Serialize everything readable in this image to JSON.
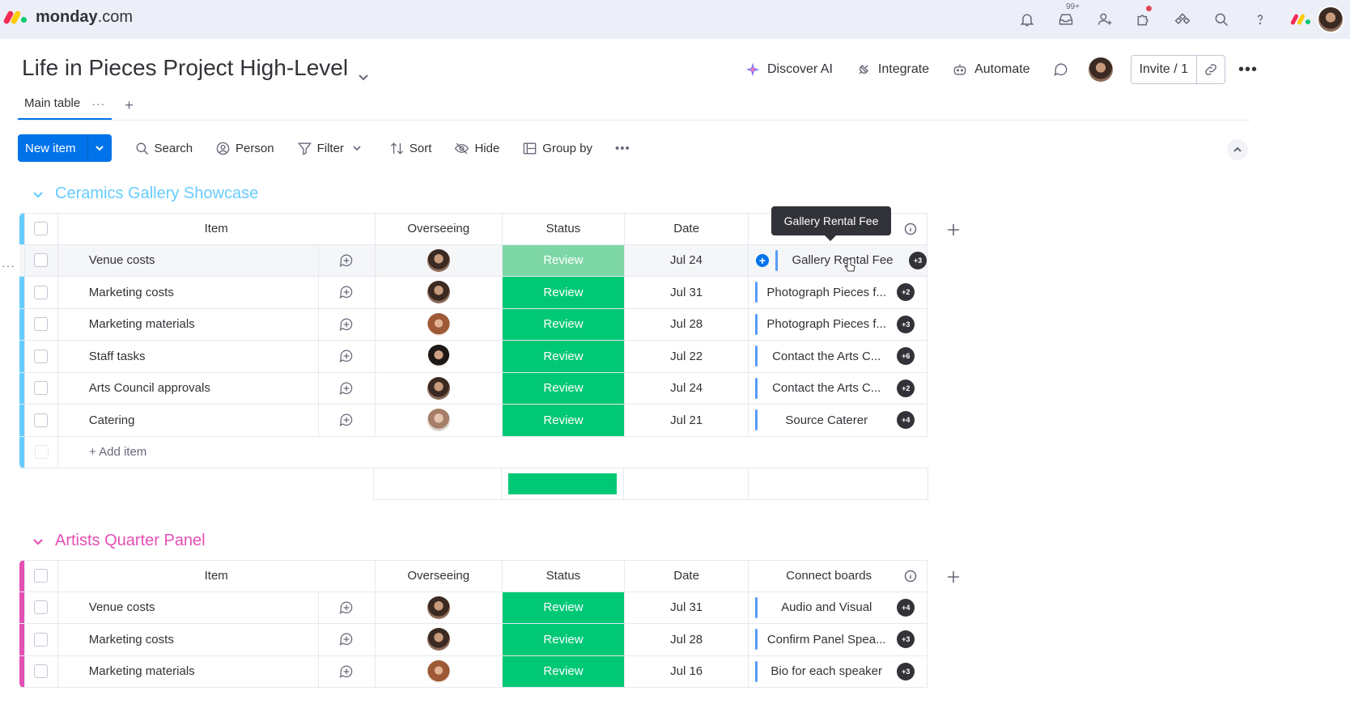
{
  "app": {
    "logo_bold": "monday",
    "logo_rest": ".com",
    "notification_badge": "99+",
    "icons": [
      "bell-icon",
      "inbox-icon",
      "invite-user-icon",
      "puzzle-icon",
      "integrations-icon",
      "search-icon",
      "help-icon"
    ]
  },
  "board": {
    "title": "Life in Pieces Project High-Level",
    "actions": {
      "discover_ai": "Discover AI",
      "integrate": "Integrate",
      "automate": "Automate",
      "invite": "Invite / 1"
    },
    "tabs": [
      {
        "label": "Main table"
      }
    ]
  },
  "toolbar": {
    "new_item": "New item",
    "search": "Search",
    "person": "Person",
    "filter": "Filter",
    "sort": "Sort",
    "hide": "Hide",
    "group_by": "Group by"
  },
  "columns": {
    "item": "Item",
    "overseeing": "Overseeing",
    "status": "Status",
    "date": "Date",
    "connect_boards": "Connect boards"
  },
  "tooltip": "Gallery Rental Fee",
  "colors": {
    "accent": "#0073ea",
    "status_review": "#00c875",
    "group1": "#66ccff",
    "group2": "#e44fb4"
  },
  "groups": [
    {
      "title": "Ceramics Gallery Showcase",
      "add_item": "+ Add item",
      "rows": [
        {
          "item": "Venue costs",
          "status": "Review",
          "date": "Jul 24",
          "connect": "Gallery Rental Fee",
          "more": "+3"
        },
        {
          "item": "Marketing costs",
          "status": "Review",
          "date": "Jul 31",
          "connect": "Photograph Pieces f...",
          "more": "+2"
        },
        {
          "item": "Marketing materials",
          "status": "Review",
          "date": "Jul 28",
          "connect": "Photograph Pieces f...",
          "more": "+3"
        },
        {
          "item": "Staff tasks",
          "status": "Review",
          "date": "Jul 22",
          "connect": "Contact the Arts C...",
          "more": "+6"
        },
        {
          "item": "Arts Council approvals",
          "status": "Review",
          "date": "Jul 24",
          "connect": "Contact the Arts C...",
          "more": "+2"
        },
        {
          "item": "Catering",
          "status": "Review",
          "date": "Jul 21",
          "connect": "Source Caterer",
          "more": "+4"
        }
      ]
    },
    {
      "title": "Artists Quarter Panel",
      "rows": [
        {
          "item": "Venue costs",
          "status": "Review",
          "date": "Jul 31",
          "connect": "Audio and Visual",
          "more": "+4"
        },
        {
          "item": "Marketing costs",
          "status": "Review",
          "date": "Jul 28",
          "connect": "Confirm Panel Spea...",
          "more": "+3"
        },
        {
          "item": "Marketing materials",
          "status": "Review",
          "date": "Jul 16",
          "connect": "Bio for each speaker",
          "more": "+3"
        }
      ]
    }
  ]
}
